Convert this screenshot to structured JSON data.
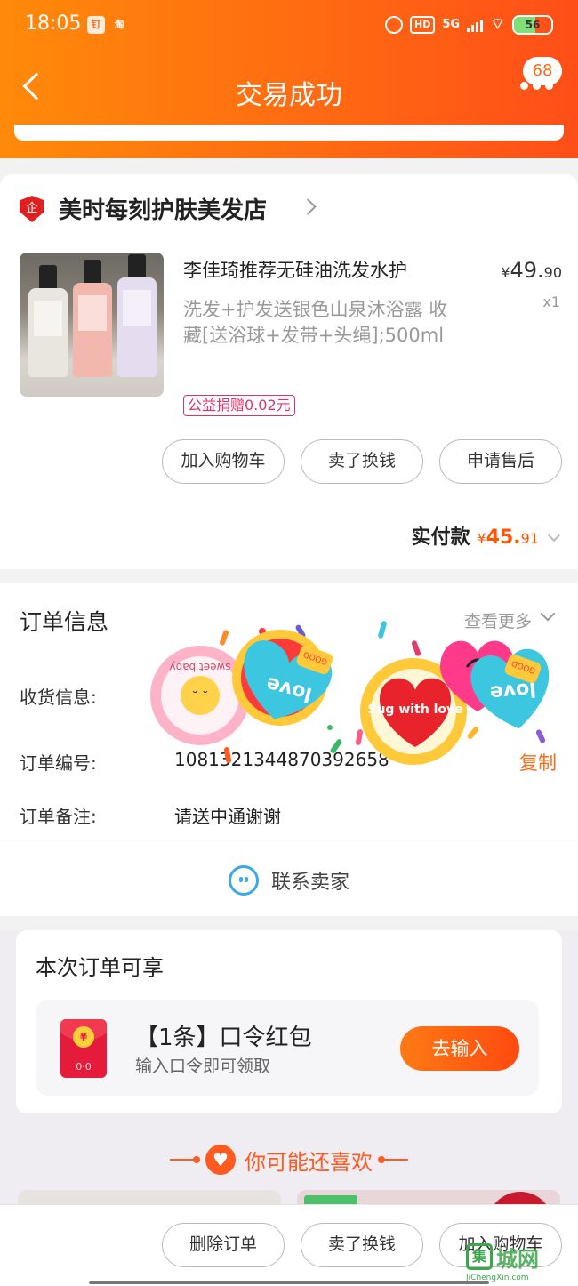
{
  "status_bar": {
    "time": "18:05",
    "app_icon_1": "钉",
    "app_icon_2": "淘",
    "hd": "HD",
    "network": "5G",
    "battery": "56",
    "battery_fraction": 0.56
  },
  "nav": {
    "title": "交易成功",
    "badge": "68"
  },
  "shop": {
    "name": "美时每刻护肤美发店",
    "logo_text": "企"
  },
  "product": {
    "title": "李佳琦推荐无硅油洗发水护",
    "price_symbol": "¥",
    "price_int": "49.",
    "price_dec": "90",
    "quantity": "x1",
    "spec": "洗发+护发送银色山泉沐浴露 收藏[送浴球+发带+头绳];500ml",
    "charity_tag": "公益捐赠0.02元"
  },
  "product_actions": {
    "add_cart": "加入购物车",
    "resell": "卖了换钱",
    "after_sale": "申请售后"
  },
  "payment": {
    "label": "实付款",
    "symbol": "¥",
    "int": "45.",
    "dec": "91"
  },
  "order_info": {
    "title": "订单信息",
    "more": "查看更多",
    "receiving_label": "收货信息:",
    "order_no_label": "订单编号:",
    "order_no": "1081321344870392658",
    "copy": "复制",
    "note_label": "订单备注:",
    "note": "请送中通谢谢",
    "contact": "联系卖家"
  },
  "benefits": {
    "title": "本次订单可享",
    "item_name": "【1条】口令红包",
    "item_sub": "输入口令即可领取",
    "button": "去输入",
    "redpack_coin": "¥",
    "redpack_face": "0·0"
  },
  "recommend": {
    "title": "你可能还喜欢",
    "heart": "♥"
  },
  "bottom_actions": {
    "delete": "删除订单",
    "resell": "卖了换钱",
    "add_cart": "加入购物车"
  },
  "stickers": {
    "s1": "sweet baby",
    "s2": "love",
    "s3": "GOOD",
    "s4": "Sug with love",
    "s5": "love",
    "s6": "GOOD"
  },
  "watermark": {
    "box": "集",
    "text": "城网",
    "url": "JiChengXin.com"
  },
  "colors": {
    "brand_orange": "#ff6a12",
    "price_orange": "#ff5500",
    "charity_pink": "#e0336b",
    "contact_blue": "#3aa9e8"
  }
}
